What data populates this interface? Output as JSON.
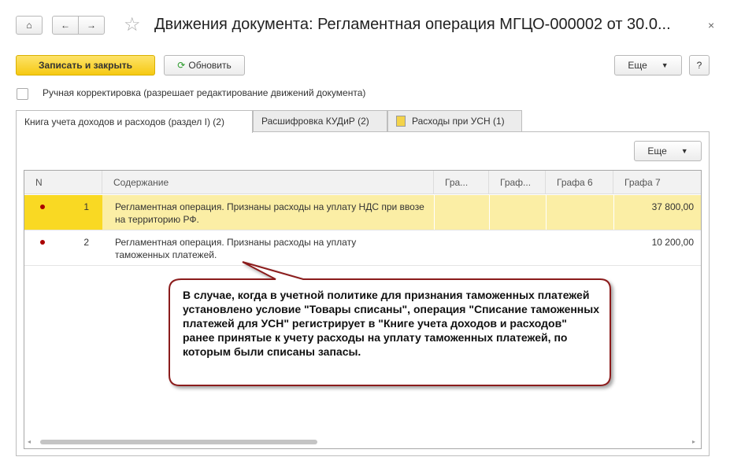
{
  "window": {
    "title": "Движения документа: Регламентная операция МГЦО-000002 от 30.0...",
    "close": "×"
  },
  "toolbar": {
    "save_close": "Записать и закрыть",
    "refresh": "Обновить",
    "more": "Еще",
    "help": "?"
  },
  "manual_edit": {
    "label": "Ручная корректировка (разрешает редактирование движений документа)",
    "checked": false
  },
  "tabs": [
    {
      "label": "Книга учета доходов и расходов (раздел I) (2)"
    },
    {
      "label": "Расшифровка КУДиР (2)"
    },
    {
      "label": "Расходы при УСН (1)"
    }
  ],
  "table": {
    "more": "Еще",
    "columns": [
      "N",
      "Содержание",
      "Гра...",
      "Граф...",
      "Графа 6",
      "Графа 7"
    ],
    "rows": [
      {
        "n": "1",
        "content": "Регламентная операция. Признаны расходы на уплату НДС при ввозе на территорию РФ.",
        "g7": "37 800,00"
      },
      {
        "n": "2",
        "content": "Регламентная операция. Признаны расходы на уплату таможенных платежей.",
        "g7": "10 200,00"
      }
    ]
  },
  "callout": "В случае, когда в учетной политике для признания таможенных платежей установлено условие \"Товары списаны\", операция \"Списание таможенных платежей для УСН\" регистрирует в \"Книге учета доходов и расходов\" ранее принятые к учету расходы на уплату таможенных платежей, по которым были списаны запасы."
}
